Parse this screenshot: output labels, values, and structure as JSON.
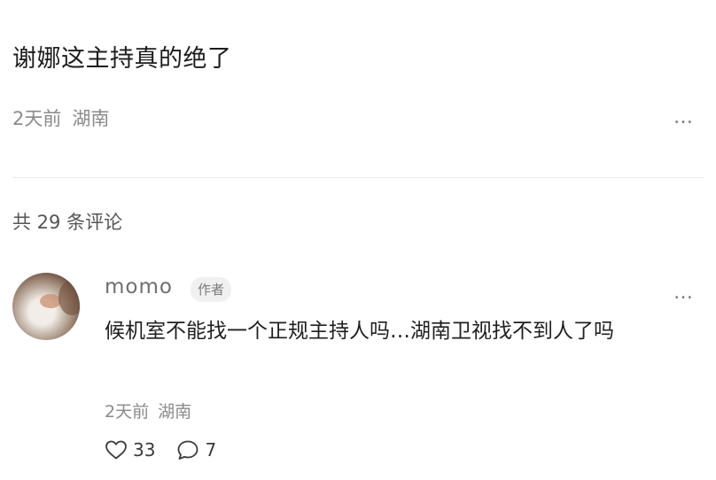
{
  "post": {
    "title": "谢娜这主持真的绝了",
    "time": "2天前",
    "location": "湖南",
    "more_icon": "…"
  },
  "comments_header": {
    "count_text": "共 29 条评论"
  },
  "comment": {
    "username": "momo",
    "badge": "作者",
    "text": "候机室不能找一个正规主持人吗…湖南卫视找不到人了吗",
    "time": "2天前",
    "location": "湖南",
    "more_icon": "…",
    "likes": "33",
    "replies": "7"
  }
}
